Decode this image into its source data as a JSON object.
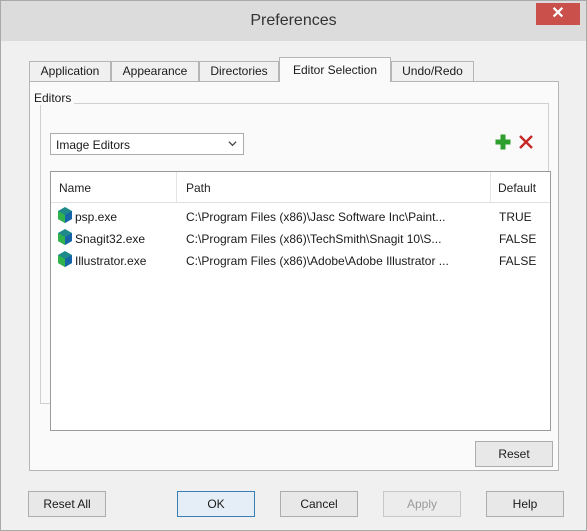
{
  "window": {
    "title": "Preferences",
    "close_glyph": "✕"
  },
  "tabs": [
    {
      "label": "Application"
    },
    {
      "label": "Appearance"
    },
    {
      "label": "Directories"
    },
    {
      "label": "Editor Selection",
      "active": true
    },
    {
      "label": "Undo/Redo"
    }
  ],
  "editors": {
    "group_label": "Editors",
    "combo_value": "Image Editors",
    "add_icon": "green-plus-icon",
    "remove_icon": "red-x-icon",
    "columns": {
      "name": "Name",
      "path": "Path",
      "default": "Default"
    },
    "rows": [
      {
        "name": "psp.exe",
        "path": "C:\\Program Files (x86)\\Jasc Software Inc\\Paint...",
        "default": "TRUE"
      },
      {
        "name": "Snagit32.exe",
        "path": "C:\\Program Files (x86)\\TechSmith\\Snagit 10\\S...",
        "default": "FALSE"
      },
      {
        "name": "Illustrator.exe",
        "path": "C:\\Program Files (x86)\\Adobe\\Adobe Illustrator ...",
        "default": "FALSE"
      }
    ],
    "reset_label": "Reset"
  },
  "footer": {
    "reset_all_label": "Reset All",
    "ok_label": "OK",
    "cancel_label": "Cancel",
    "apply_label": "Apply",
    "help_label": "Help"
  },
  "colors": {
    "close_button": "#c9504b",
    "add_icon": "#2e9e2e",
    "remove_icon": "#c62828",
    "default_button_border": "#3c7fb1"
  }
}
